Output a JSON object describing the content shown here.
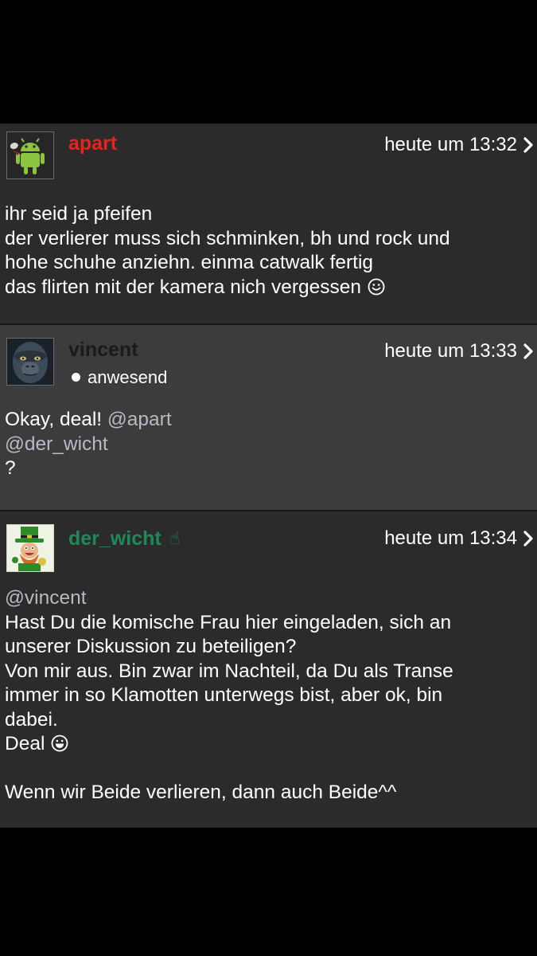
{
  "posts": [
    {
      "username": "apart",
      "username_color": "#e8231e",
      "avatar": "android-robot-avatar",
      "time": "heute um 13:32",
      "lines": [
        "ihr seid ja pfeifen",
        "der verlierer muss sich schminken, bh und rock und",
        "hohe schuhe anziehn. einma catwalk fertig",
        "das flirten mit der kamera nich vergessen"
      ],
      "emoji": "smiley-icon"
    },
    {
      "username": "vincent",
      "username_color": "#1a1a1a",
      "avatar": "ape-face-avatar",
      "status": "anwesend",
      "time": "heute um 13:33",
      "line1_text": "Okay, deal! ",
      "line1_mention": "@apart",
      "line2_mention": "@der_wicht",
      "line3_text": "?"
    },
    {
      "username": "der_wicht",
      "username_color": "#1f8a58",
      "mod_icon": "hand-icon",
      "avatar": "leprechaun-avatar",
      "time": "heute um 13:34",
      "mention": "@vincent",
      "lines": [
        "Hast Du die komische Frau hier eingeladen, sich an",
        "unserer Diskussion zu beteiligen?",
        "Von mir aus. Bin zwar im Nachteil, da Du als Transe",
        "immer in so Klamotten unterwegs bist, aber ok, bin",
        "dabei."
      ],
      "deal_text": "Deal",
      "deal_emoji": "grin-icon",
      "last_line": "Wenn wir Beide verlieren, dann auch Beide^^"
    }
  ]
}
